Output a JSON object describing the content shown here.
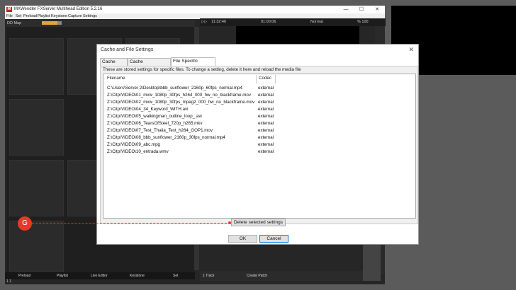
{
  "app": {
    "title": "MXWendler FXServer Multihead Edition 5.2.16",
    "menu": [
      "File",
      "Set",
      "Preload",
      "Playlist",
      "Keystone",
      "Capture",
      "Settings"
    ],
    "left_header_label": "DD Map",
    "bottom_tabs": [
      "Preload",
      "Playlist",
      "Live Editor",
      "Keystone",
      "Set"
    ],
    "status_left": "1 1",
    "timeline": {
      "time1": "11:32:46",
      "time2": "01:00:06",
      "mode": "Normal",
      "pct": "% 100"
    },
    "bottom_strip": {
      "track": "1 Track",
      "create": "Create Patch"
    }
  },
  "dialog": {
    "title": "Cache and File Settings",
    "close": "✕",
    "tabs": [
      "Cache Path",
      "Cache Management",
      "File Specific Settings"
    ],
    "active_tab": 2,
    "description": "These are stored settings for specific files. To change a setting, delete it here and reload the media file",
    "columns": {
      "filename": "Filename",
      "codec": "Codec"
    },
    "rows": [
      {
        "filename": "C:\\Users\\Server 2\\Desktop\\bbb_sunflower_2160p_60fps_normal.mp4",
        "codec": "external"
      },
      {
        "filename": "Z:\\Citp\\VIDEO\\01_mxw_1080p_30fps_h264_000_hw_no_blackframe.mov",
        "codec": "external"
      },
      {
        "filename": "Z:\\Citp\\VIDEO\\02_mxw_1080p_30fps_mpeg2_000_hw_no_blackframe.mov",
        "codec": "external"
      },
      {
        "filename": "Z:\\Citp\\VIDEO\\04_34_Keyword_WITH.avi",
        "codec": "external"
      },
      {
        "filename": "Z:\\Citp\\VIDEO\\05_walkingman_outline_loop_.avi",
        "codec": "external"
      },
      {
        "filename": "Z:\\Citp\\VIDEO\\06_TearsOfSteel_720p_h265.mkv",
        "codec": "external"
      },
      {
        "filename": "Z:\\Citp\\VIDEO\\07_Test_Thalia_Text_h264_GOP1.mov",
        "codec": "external"
      },
      {
        "filename": "Z:\\Citp\\VIDEO\\08_bbb_sunflower_2160p_30fps_normal.mp4",
        "codec": "external"
      },
      {
        "filename": "Z:\\Citp\\VIDEO\\09_abc.mpg",
        "codec": "external"
      },
      {
        "filename": "Z:\\Citp\\VIDEO\\10_entrada.wmv",
        "codec": "external"
      }
    ],
    "delete_label": "Delete selected settings",
    "ok_label": "OK",
    "cancel_label": "Cancel"
  },
  "annotation": {
    "marker_label": "G",
    "color": "#e53a2a"
  }
}
